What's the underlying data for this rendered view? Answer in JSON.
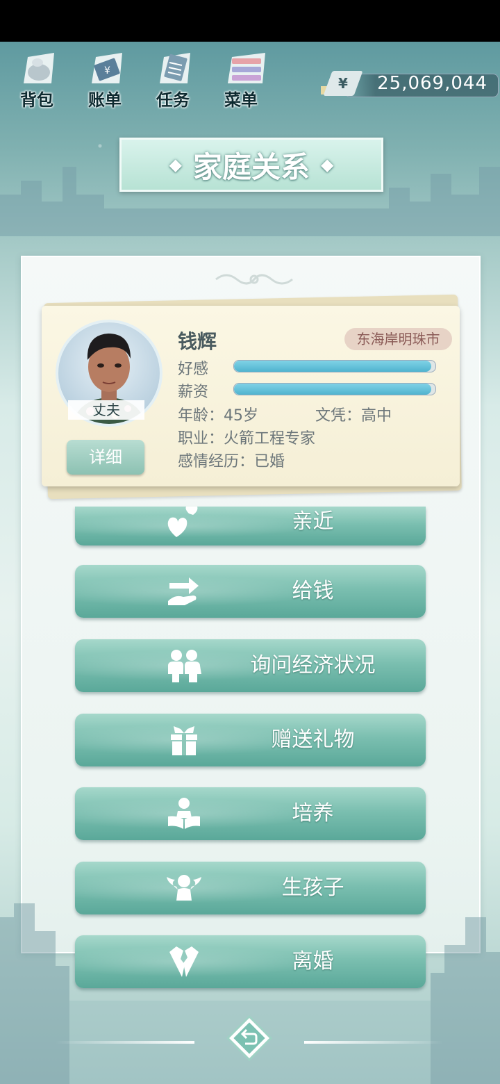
{
  "top_menu": {
    "bag": "背包",
    "bill": "账单",
    "task": "任务",
    "menu": "菜单"
  },
  "money": {
    "currency_symbol": "¥",
    "amount": "25,069,044"
  },
  "title": {
    "text": "家庭关系",
    "ornament": "◆"
  },
  "profile": {
    "name": "钱辉",
    "city": "东海岸明珠市",
    "role": "丈夫",
    "favor_label": "好感",
    "favor_value": 0.98,
    "salary_label": "薪资",
    "salary_value": 0.98,
    "age": "年龄：45岁",
    "education": "文凭：高中",
    "occupation": "职业：火箭工程专家",
    "relationship": "感情经历：已婚",
    "detail_button": "详细"
  },
  "actions": [
    {
      "label": "亲近",
      "icon": "hearts-icon"
    },
    {
      "label": "给钱",
      "icon": "give-money-icon"
    },
    {
      "label": "询问经济状况",
      "icon": "people-icon"
    },
    {
      "label": "赠送礼物",
      "icon": "gift-icon"
    },
    {
      "label": "培养",
      "icon": "reading-icon"
    },
    {
      "label": "生孩子",
      "icon": "angel-icon"
    },
    {
      "label": "离婚",
      "icon": "broken-heart-icon"
    }
  ],
  "colors": {
    "accent_teal": "#7bbfb0",
    "bar_fill": "#4fb3cf",
    "city_badge": "#e7d3c6"
  }
}
